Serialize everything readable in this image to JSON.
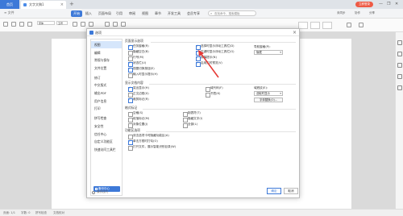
{
  "titlebar": {
    "home_tab": "首页",
    "doc_tab": "文字文稿1",
    "new_tab": "+",
    "login": "立即登录",
    "controls": [
      "—",
      "❐",
      "✕"
    ]
  },
  "ribbon": {
    "menu": "≡ 文件",
    "tabs": [
      "开始",
      "插入",
      "页面布局",
      "引用",
      "审阅",
      "视图",
      "章节",
      "开发工具",
      "会员专享"
    ],
    "active_tab": "开始",
    "search_placeholder": "查找命令、搜索模板",
    "right": [
      "未同步",
      "协作",
      "分享"
    ]
  },
  "toolbar": {
    "font": "宋体",
    "size": "五号"
  },
  "dialog": {
    "title": "选项",
    "sidebar": [
      "视图",
      "编辑",
      "常规与保存",
      "文件位置",
      "修订",
      "中文版式",
      "输出PDF",
      "用户信息",
      "打印",
      "拼写检查",
      "安全性",
      "信任中心",
      "自定义功能区",
      "快速访问工具栏"
    ],
    "active_item": "视图",
    "backup_btn": "备份中心",
    "groups": {
      "page_display": {
        "title": "页面显示选项",
        "items": [
          {
            "label": "任务窗格(R)",
            "checked": true
          },
          {
            "label": "隐藏空白(B)",
            "checked": false
          },
          {
            "label": "行号(M)",
            "checked": false
          },
          {
            "label": "状态栏(U)",
            "checked": true
          },
          {
            "label": "视图切换按钮(E)",
            "checked": true
          },
          {
            "label": "输入时显示提示(H)",
            "checked": false
          },
          {
            "label": "选择时显示浮动工具栏(D)",
            "checked": true
          },
          {
            "label": "右键时显示浮动工具栏(G)",
            "checked": true
          },
          {
            "label": "屏幕提示(N)",
            "checked": true
          },
          {
            "label": "启用实时预览(V)",
            "checked": true
          }
        ],
        "nav_pane_label": "导航窗格(P):",
        "nav_pane_value": "隐藏"
      },
      "format_marks": {
        "title": "显示文档内容",
        "items": [
          {
            "label": "突出显示(H)",
            "checked": true
          },
          {
            "label": "正文边框(X)",
            "checked": false
          },
          {
            "label": "裁剪标记(R)",
            "checked": true
          },
          {
            "label": "域代码(F)",
            "checked": false
          },
          {
            "label": "书签(K)",
            "checked": false
          }
        ],
        "shading_label": "域底纹(E):",
        "shading_value": "选取时显示",
        "font_btn": "字体替换(O)..."
      },
      "marks": {
        "title": "格式标记",
        "items": [
          {
            "label": "空格(S)",
            "checked": false
          },
          {
            "label": "制表符(T)",
            "checked": false
          },
          {
            "label": "段落标记(M)",
            "checked": false
          },
          {
            "label": "隐藏文字(I)",
            "checked": false
          },
          {
            "label": "对象位置(J)",
            "checked": false
          },
          {
            "label": "全部(L)",
            "checked": false
          }
        ]
      },
      "function_window": {
        "title": "功能区选项",
        "items": [
          {
            "label": "双击选项卡时隐藏功能区(A)",
            "checked": false
          },
          {
            "label": "单击方框时打勾(O)",
            "checked": true
          },
          {
            "label": "打开文件，展示智能识别目录(W)",
            "checked": false
          }
        ]
      }
    },
    "tips": "操作技巧",
    "ok": "确定",
    "cancel": "取消"
  },
  "statusbar": {
    "page": "页面: 1/1",
    "words": "字数: 0",
    "spell": "拼写检查",
    "proofread": "文档校对"
  },
  "colors": {
    "accent": "#3d79d8",
    "arrow": "#e53935",
    "login": "#ee5a45"
  },
  "icons": [
    "search-icon",
    "close-icon",
    "chevron-down-icon",
    "backup-icon",
    "help-icon",
    "document-icon"
  ]
}
